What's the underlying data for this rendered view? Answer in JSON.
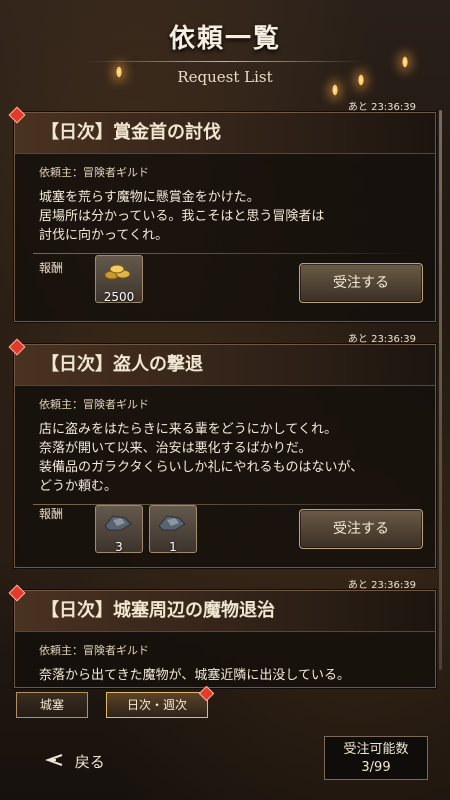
{
  "header": {
    "title": "依頼一覧",
    "subtitle": "Request List"
  },
  "quests": [
    {
      "timer": "あと 23:36:39",
      "title": "【日次】賞金首の討伐",
      "client": "依頼主：冒険者ギルド",
      "description": "城塞を荒らす魔物に懸賞金をかけた。\n居場所は分かっている。我こそはと思う冒険者は\n討伐に向かってくれ。",
      "reward_label": "報酬",
      "rewards": [
        {
          "icon": "gold-coins-icon",
          "qty": "2500"
        }
      ],
      "accept_label": "受注する"
    },
    {
      "timer": "あと 23:36:39",
      "title": "【日次】盗人の撃退",
      "client": "依頼主：冒険者ギルド",
      "description": "店に盗みをはたらきに来る輩をどうにかしてくれ。\n奈落が開いて以来、治安は悪化するばかりだ。\n装備品のガラクタくらいしか礼にやれるものはないが、\nどうか頼む。",
      "reward_label": "報酬",
      "rewards": [
        {
          "icon": "scrap-material-icon",
          "qty": "3"
        },
        {
          "icon": "scrap-material-icon",
          "qty": "1"
        }
      ],
      "accept_label": "受注する"
    },
    {
      "timer": "あと 23:36:39",
      "title": "【日次】城塞周辺の魔物退治",
      "client": "依頼主：冒険者ギルド",
      "description": "奈落から出てきた魔物が、城塞近隣に出没している。"
    }
  ],
  "filters": [
    {
      "label": "城塞",
      "active": false
    },
    {
      "label": "日次・週次",
      "active": true
    }
  ],
  "footer": {
    "back_label": "戻る",
    "capacity_label": "受注可能数",
    "capacity_value": "3/99"
  },
  "colors": {
    "accent": "#e23b2b",
    "gold_border": "#bba37c"
  }
}
